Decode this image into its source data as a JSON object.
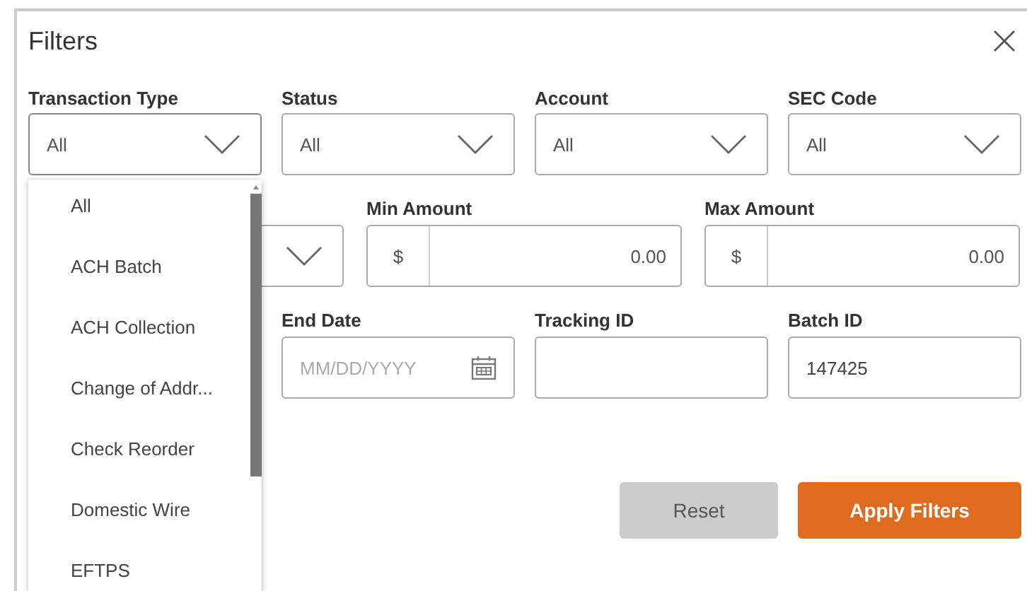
{
  "dialog": {
    "title": "Filters"
  },
  "rows": [
    {
      "fields": [
        {
          "kind": "select",
          "label": "Transaction Type",
          "value": "All",
          "open": true
        },
        {
          "kind": "select",
          "label": "Status",
          "value": "All",
          "open": false
        },
        {
          "kind": "select",
          "label": "Account",
          "value": "All",
          "open": false
        },
        {
          "kind": "select",
          "label": "SEC Code",
          "value": "All",
          "open": false
        }
      ]
    },
    {
      "fields": [
        {
          "kind": "select",
          "open": false
        },
        {
          "kind": "amount",
          "label": "Min Amount",
          "prefix": "$",
          "value": "0.00"
        },
        {
          "kind": "amount",
          "label": "Max Amount",
          "prefix": "$",
          "value": "0.00"
        }
      ]
    },
    {
      "fields": [
        {
          "kind": "date",
          "label": "End Date",
          "placeholder": "MM/DD/YYYY"
        },
        {
          "kind": "text",
          "label": "Tracking ID"
        },
        {
          "kind": "text",
          "label": "Batch ID",
          "value": "147425"
        }
      ]
    }
  ],
  "dropdown": {
    "items": [
      {
        "label": "All"
      },
      {
        "label": "ACH Batch"
      },
      {
        "label": "ACH Collection"
      },
      {
        "label": "Change of Addr..."
      },
      {
        "label": "Check Reorder"
      },
      {
        "label": "Domestic Wire"
      },
      {
        "label": "EFTPS"
      }
    ]
  },
  "buttons": [
    {
      "label": "Reset",
      "kind": "secondary"
    },
    {
      "label": "Apply Filters",
      "kind": "primary"
    }
  ]
}
